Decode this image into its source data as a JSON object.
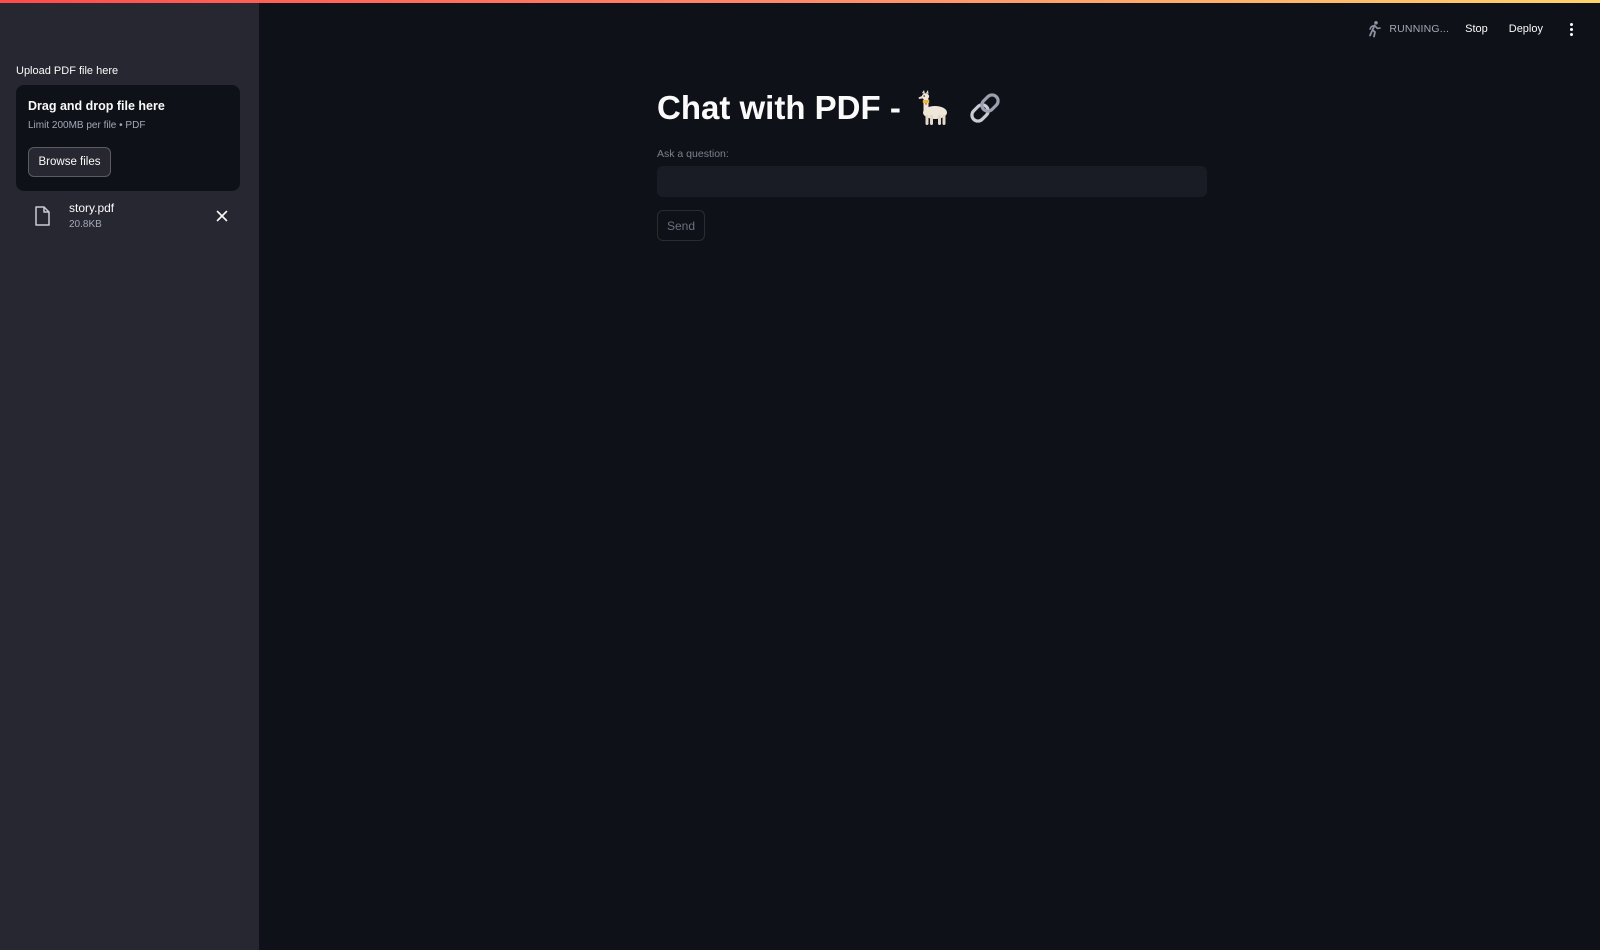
{
  "sidebar": {
    "upload_label": "Upload PDF file here",
    "dropzone": {
      "title": "Drag and drop file here",
      "limit": "Limit 200MB per file • PDF",
      "browse_label": "Browse files"
    },
    "file": {
      "name": "story.pdf",
      "size": "20.8KB"
    }
  },
  "header": {
    "status": "RUNNING...",
    "stop_label": "Stop",
    "deploy_label": "Deploy"
  },
  "main": {
    "title": "Chat with PDF -",
    "title_icons": [
      "llama-emoji",
      "link-emoji"
    ],
    "question_label": "Ask a question:",
    "question_value": "",
    "send_label": "Send"
  },
  "colors": {
    "background": "#0e1117",
    "sidebar": "#262730",
    "text": "#fafafa",
    "muted": "#a3a8b8",
    "accent_stripe_start": "#ff4b4b",
    "accent_stripe_end": "#ffd36b"
  }
}
